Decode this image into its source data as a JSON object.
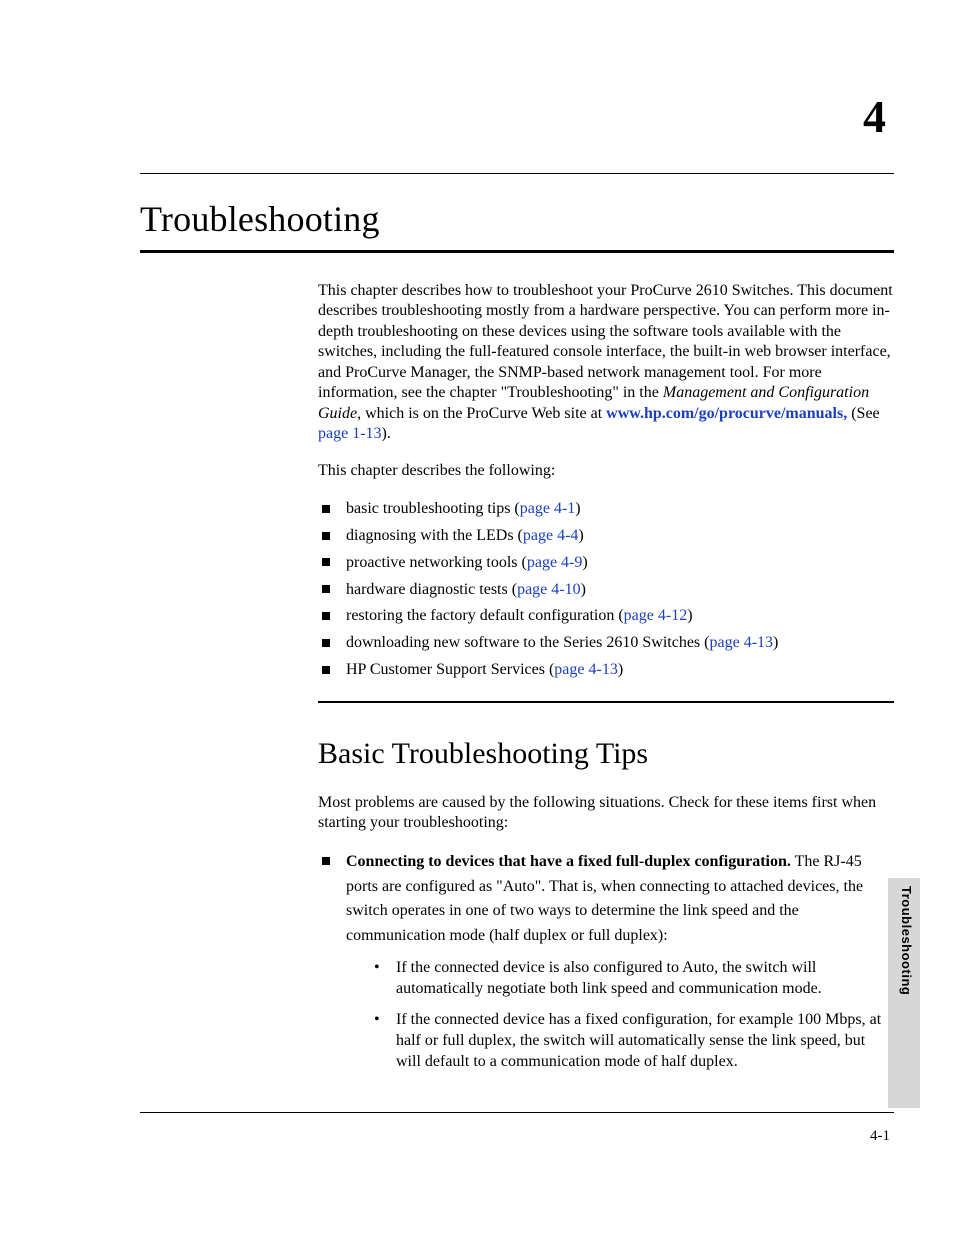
{
  "chapter": {
    "number": "4",
    "title": "Troubleshooting"
  },
  "intro": {
    "p1_a": "This chapter describes how to troubleshoot your ProCurve 2610 Switches. This document describes troubleshooting mostly from a hardware perspective. You can perform more in-depth troubleshooting on these devices using the software tools available with the switches, including the full-featured console interface, the built-in web browser interface, and ProCurve Manager, the SNMP-based network management tool. For more information, see the chapter \"Troubleshooting\" in the ",
    "p1_em": "Management and Configuration Guide",
    "p1_b": ", which is on the ProCurve Web site at ",
    "p1_link": "www.hp.com/go/procurve/manuals,",
    "p1_c": " (See ",
    "p1_ref": "page 1-13",
    "p1_d": ").",
    "p2": "This chapter describes the following:"
  },
  "toc": [
    {
      "text": "basic troubleshooting tips (",
      "ref": "page 4-1",
      "tail": ")"
    },
    {
      "text": "diagnosing with the LEDs (",
      "ref": "page 4-4",
      "tail": ")"
    },
    {
      "text": "proactive networking tools (",
      "ref": "page 4-9",
      "tail": ")"
    },
    {
      "text": "hardware diagnostic tests (",
      "ref": "page 4-10",
      "tail": ")"
    },
    {
      "text": "restoring the factory default configuration (",
      "ref": "page 4-12",
      "tail": ")"
    },
    {
      "text": "downloading new software to the Series 2610 Switches (",
      "ref": "page 4-13",
      "tail": ")"
    },
    {
      "text": "HP Customer Support Services (",
      "ref": "page 4-13",
      "tail": ")"
    }
  ],
  "section": {
    "title": "Basic Troubleshooting Tips",
    "p1": "Most problems are caused by the following situations. Check for these items first when starting your troubleshooting:",
    "item1_lead": "Connecting to devices that have a fixed full-duplex configuration.",
    "item1_body": " The RJ-45 ports are configured as \"Auto\". That is, when connecting to attached devices, the switch operates in one of two ways to determine the link speed and the communication mode (half duplex or full duplex):",
    "sub1": "If the connected device is also configured to Auto, the switch will automatically negotiate both link speed and communication mode.",
    "sub2": "If the connected device has a fixed configuration, for example 100 Mbps, at half or full duplex, the switch will automatically sense the link speed, but will default to a communication mode of half duplex."
  },
  "footer": {
    "page": "4-1",
    "tab": "Troubleshooting"
  }
}
